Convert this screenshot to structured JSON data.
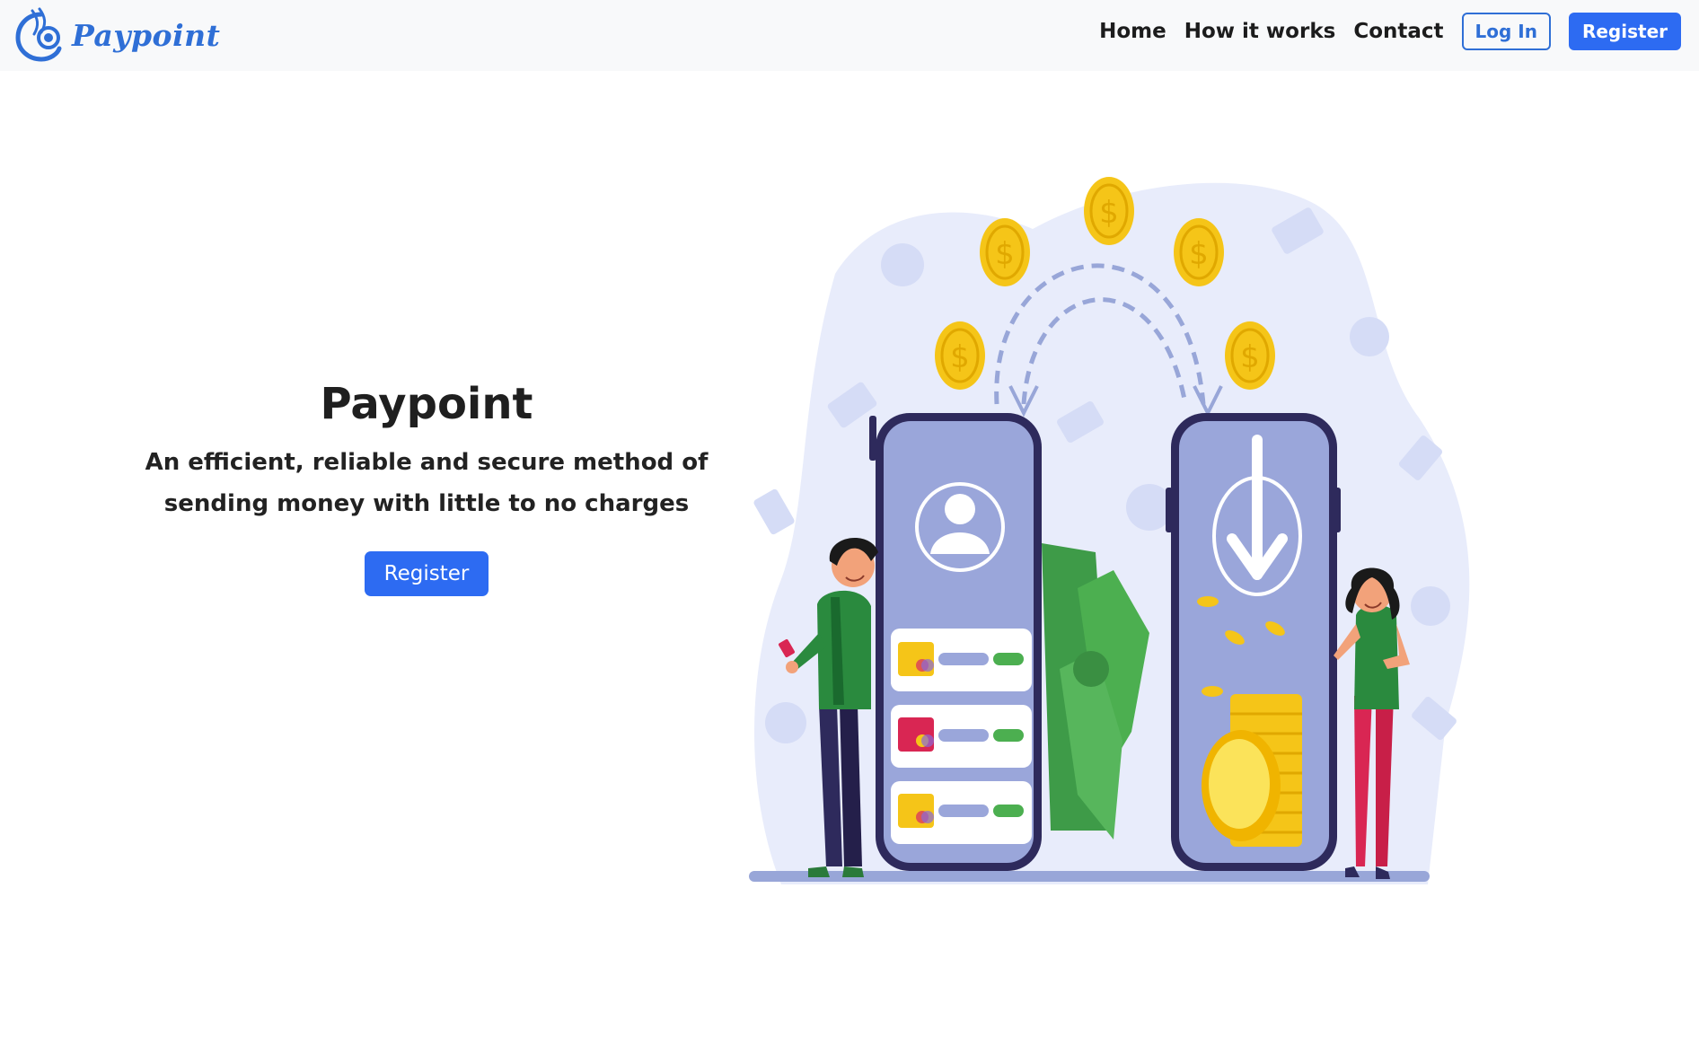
{
  "navbar": {
    "brand": "Paypoint",
    "links": [
      "Home",
      "How it works",
      "Contact"
    ],
    "login_label": "Log In",
    "register_label": "Register"
  },
  "hero": {
    "title": "Paypoint",
    "subtitle": "An efficient, reliable and secure method of sending money with little to no charges",
    "cta_label": "Register"
  },
  "colors": {
    "accent": "#2d6bf2",
    "brand_text": "#2f6fd6",
    "navbar_bg": "#f8f9fa",
    "coin": "#f5c518",
    "phone": "#9aa6da",
    "phone_border": "#2e2a5c",
    "blob": "#e8ecfb",
    "cash": "#4caf50"
  },
  "icons": [
    "paypoint-logo-icon",
    "user-icon",
    "download-arrow-icon",
    "dollar-coin-icon",
    "credit-card-icon"
  ]
}
